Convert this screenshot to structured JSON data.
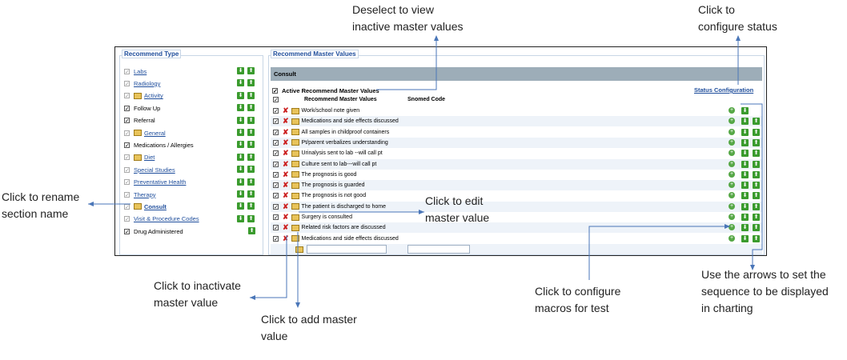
{
  "left_panel": {
    "title": "Recommend Type",
    "items": [
      {
        "label": "Labs",
        "style": "link",
        "checked": "grey",
        "folder": false,
        "arrows": "down-up"
      },
      {
        "label": "Radiology",
        "style": "link",
        "checked": "grey",
        "folder": false,
        "arrows": "down-up"
      },
      {
        "label": "Activity",
        "style": "link",
        "checked": "grey",
        "folder": true,
        "arrows": "down-up"
      },
      {
        "label": "Follow Up",
        "style": "plain",
        "checked": "dark",
        "folder": false,
        "arrows": "down-up"
      },
      {
        "label": "Referral",
        "style": "plain",
        "checked": "dark",
        "folder": false,
        "arrows": "down-up"
      },
      {
        "label": "General",
        "style": "link",
        "checked": "grey",
        "folder": true,
        "arrows": "down-up"
      },
      {
        "label": "Medications / Allergies",
        "style": "plain",
        "checked": "dark",
        "folder": false,
        "arrows": "down-up"
      },
      {
        "label": "Diet",
        "style": "link",
        "checked": "grey",
        "folder": true,
        "arrows": "down-up"
      },
      {
        "label": "Special Studies",
        "style": "link",
        "checked": "grey",
        "folder": false,
        "arrows": "down-up"
      },
      {
        "label": "Preventative Health",
        "style": "link",
        "checked": "grey",
        "folder": false,
        "arrows": "down-up"
      },
      {
        "label": "Therapy",
        "style": "link",
        "checked": "grey",
        "folder": false,
        "arrows": "down-up"
      },
      {
        "label": "Consult",
        "style": "selected",
        "checked": "grey",
        "folder": true,
        "arrows": "down-up"
      },
      {
        "label": "Visit & Procedure Codes",
        "style": "link",
        "checked": "grey",
        "folder": false,
        "arrows": "down-up"
      },
      {
        "label": "Drug Administered",
        "style": "plain",
        "checked": "dark",
        "folder": false,
        "arrows": "up"
      }
    ]
  },
  "right_panel": {
    "title": "Recommend Master Values",
    "section_header": "Consult",
    "active_label": "Active Recommend Master Values",
    "status_link": "Status Configuration",
    "col_values": "Recommend Master Values",
    "col_snomed": "Snomed Code",
    "rows": [
      "Work/school note given",
      "Medications and side effects discussed",
      "All samples in childproof containers",
      "Pt/parent verbalizes understanding",
      "Urinalysis sent to lab --will call pt",
      "Culture sent to lab---will call pt",
      "The prognosis is good",
      "The prognosis is guarded",
      "The prognosis is not good",
      "The patient is discharged to home",
      "Surgery is consulted",
      "Related risk factors are discussed",
      "Medications and side effects discussed"
    ],
    "new_value": "",
    "new_snomed": ""
  },
  "annotations": {
    "deselect": "Deselect  to view\ninactive master values",
    "status": "Click to\nconfigure status",
    "rename": "Click to rename\nsection name",
    "edit": "Click to edit\nmaster value",
    "inactivate": "Click to inactivate\nmaster value",
    "add": "Click to add master\nvalue",
    "macros": "Click to configure\nmacros for test",
    "arrows": "Use the arrows to set the\nsequence to be displayed\nin charting"
  },
  "colors": {
    "arrow_green": "#3a9b2d",
    "link_blue": "#1f4e9c",
    "header_grey": "#9dadb8",
    "annotation_line": "#4a76b8"
  },
  "icons": [
    "down-arrow-icon",
    "up-arrow-icon",
    "folder-icon",
    "delete-x-icon",
    "plus-circle-icon",
    "checkbox-icon"
  ]
}
